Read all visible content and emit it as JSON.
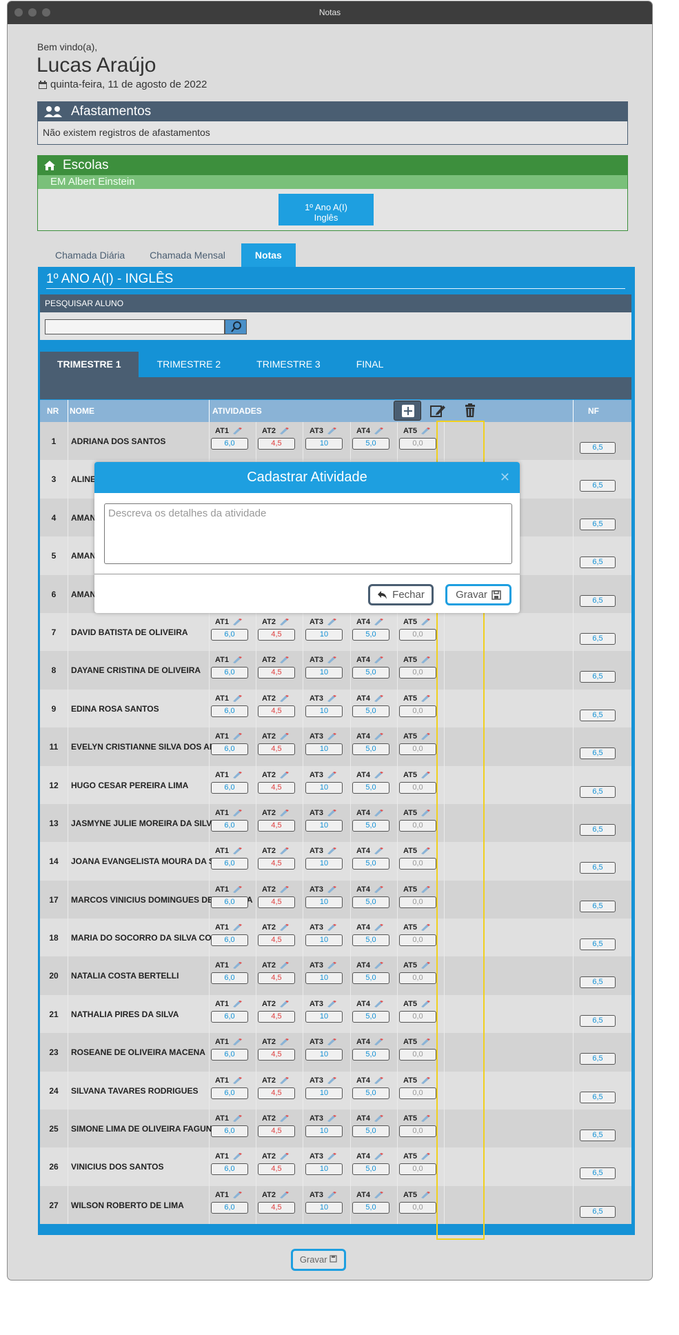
{
  "window": {
    "title": "Notas"
  },
  "user": {
    "greeting": "Bem vindo(a),",
    "name": "Lucas Araújo",
    "date": "quinta-feira, 11 de agosto de 2022"
  },
  "afastamentos": {
    "title": "Afastamentos",
    "empty": "Não existem registros de afastamentos"
  },
  "escolas": {
    "title": "Escolas",
    "school": "EM Albert Einstein",
    "class_line1": "1º Ano A(I)",
    "class_line2": "Inglês"
  },
  "tabs": [
    "Chamada Diária",
    "Chamada Mensal",
    "Notas"
  ],
  "notas": {
    "title": "1º ANO A(I) - INGLÊS",
    "search_label": "PESQUISAR ALUNO"
  },
  "trimestres": [
    "TRIMESTRE 1",
    "TRIMESTRE 2",
    "TRIMESTRE 3",
    "FINAL"
  ],
  "grid": {
    "headers": {
      "nr": "NR",
      "nome": "NOME",
      "atividades": "ATIVIDADES",
      "nf": "NF"
    },
    "activities": [
      {
        "label": "AT1",
        "grade": "6,0",
        "tone": "blue"
      },
      {
        "label": "AT2",
        "grade": "4,5",
        "tone": "red"
      },
      {
        "label": "AT3",
        "grade": "10",
        "tone": "blue"
      },
      {
        "label": "AT4",
        "grade": "5,0",
        "tone": "blue"
      },
      {
        "label": "AT5",
        "grade": "0,0",
        "tone": "grey"
      }
    ],
    "students": [
      {
        "nr": "1",
        "nome": "ADRIANA DOS SANTOS",
        "nf": "6,5"
      },
      {
        "nr": "3",
        "nome": "ALINE",
        "nf": "6,5"
      },
      {
        "nr": "4",
        "nome": "AMAN",
        "nf": "6,5"
      },
      {
        "nr": "5",
        "nome": "AMAN",
        "nf": "6,5"
      },
      {
        "nr": "6",
        "nome": "AMAN",
        "nf": "6,5"
      },
      {
        "nr": "7",
        "nome": "DAVID BATISTA DE OLIVEIRA",
        "nf": "6,5"
      },
      {
        "nr": "8",
        "nome": "DAYANE CRISTINA DE OLIVEIRA",
        "nf": "6,5"
      },
      {
        "nr": "9",
        "nome": "EDINA ROSA SANTOS",
        "nf": "6,5"
      },
      {
        "nr": "11",
        "nome": "EVELYN CRISTIANNE SILVA DOS ANJOS",
        "nf": "6,5"
      },
      {
        "nr": "12",
        "nome": "HUGO CESAR PEREIRA LIMA",
        "nf": "6,5"
      },
      {
        "nr": "13",
        "nome": "JASMYNE JULIE MOREIRA DA SILVA",
        "nf": "6,5"
      },
      {
        "nr": "14",
        "nome": "JOANA EVANGELISTA MOURA DA SILVA",
        "nf": "6,5"
      },
      {
        "nr": "17",
        "nome": "MARCOS VINICIUS DOMINGUES DE ALMEIDA",
        "nf": "6,5"
      },
      {
        "nr": "18",
        "nome": "MARIA DO SOCORRO DA SILVA COSTA",
        "nf": "6,5"
      },
      {
        "nr": "20",
        "nome": "NATALIA COSTA BERTELLI",
        "nf": "6,5"
      },
      {
        "nr": "21",
        "nome": "NATHALIA PIRES DA SILVA",
        "nf": "6,5"
      },
      {
        "nr": "23",
        "nome": "ROSEANE DE OLIVEIRA MACENA",
        "nf": "6,5"
      },
      {
        "nr": "24",
        "nome": "SILVANA TAVARES RODRIGUES",
        "nf": "6,5"
      },
      {
        "nr": "25",
        "nome": "SIMONE LIMA DE OLIVEIRA FAGUNDES",
        "nf": "6,5"
      },
      {
        "nr": "26",
        "nome": "VINICIUS DOS SANTOS",
        "nf": "6,5"
      },
      {
        "nr": "27",
        "nome": "WILSON ROBERTO DE LIMA",
        "nf": "6,5"
      }
    ]
  },
  "footer": {
    "save_label": "Gravar"
  },
  "modal": {
    "title": "Cadastrar Atividade",
    "placeholder": "Descreva os detalhes da atividade",
    "close_label": "Fechar",
    "save_label": "Gravar"
  },
  "icons": {
    "calendar": "calendar-icon",
    "users": "users-icon",
    "home": "home-icon",
    "search": "search-icon",
    "add": "plus-square-icon",
    "edit": "edit-icon",
    "delete": "trash-icon",
    "pencil": "pencil-icon",
    "undo": "undo-icon",
    "save": "floppy-icon",
    "close": "close-icon"
  },
  "colors": {
    "primary": "#1e9fe0",
    "header": "#4a5e72",
    "green": "#3d8f3d",
    "highlight": "#f0d020"
  }
}
